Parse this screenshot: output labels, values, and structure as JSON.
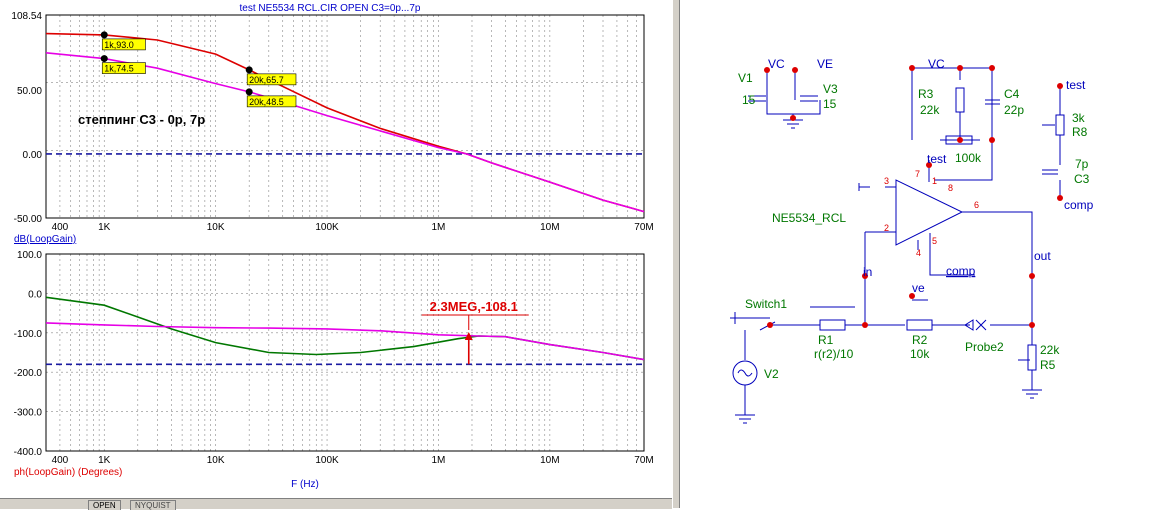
{
  "window_title": "test NE5534 RCL.CIR OPEN C3=0p...7p",
  "tabs": [
    "OPEN",
    "NYQUIST"
  ],
  "colors": {
    "red": "#dd0000",
    "magenta": "#e600e6",
    "green": "#007700",
    "blue_dash": "#1a1aa0",
    "label_bg": "#ffff00",
    "schem_blue": "#0000bb",
    "schem_green": "#007700",
    "node_red": "#dd0000"
  },
  "chart_data": [
    {
      "type": "line",
      "title": "",
      "xlabel": "",
      "ylabel": "dB(LoopGain)",
      "xscale": "log",
      "xlim": [
        300,
        70000000
      ],
      "ylim": [
        -50,
        108.54
      ],
      "x_tick_labels": [
        "400",
        "1K",
        "10K",
        "100K",
        "1M",
        "10M",
        "70M"
      ],
      "x_tick_values": [
        400,
        1000,
        10000,
        100000,
        1000000,
        10000000,
        70000000
      ],
      "y_tick_labels": [
        "108.54",
        "50.00",
        "0.00",
        "-50.00"
      ],
      "y_tick_values": [
        108.54,
        50,
        0,
        -50
      ],
      "grid": true,
      "reference_line": {
        "y": 0,
        "style": "dashed"
      },
      "annotation_text": "степпинг C3 -  0p, 7p",
      "series": [
        {
          "color": "red",
          "x": [
            300,
            1000,
            3000,
            10000,
            20000,
            30000,
            100000,
            300000,
            1000000,
            1800000,
            3000000,
            10000000,
            30000000,
            70000000
          ],
          "y": [
            94,
            93.0,
            89,
            78,
            65.7,
            58,
            36,
            20,
            6,
            0,
            -7,
            -22,
            -36,
            -45
          ]
        },
        {
          "color": "magenta",
          "x": [
            300,
            1000,
            3000,
            10000,
            20000,
            30000,
            100000,
            300000,
            1000000,
            1800000,
            3000000,
            10000000,
            30000000,
            70000000
          ],
          "y": [
            79,
            74.5,
            67,
            55,
            48.5,
            44,
            30,
            18,
            5,
            0,
            -7,
            -22,
            -36,
            -45
          ]
        }
      ],
      "markers": [
        {
          "x": 1000,
          "y": 93.0,
          "label": "1k,93.0"
        },
        {
          "x": 1000,
          "y": 74.5,
          "label": "1k,74.5"
        },
        {
          "x": 20000,
          "y": 65.7,
          "label": "20k,65.7"
        },
        {
          "x": 20000,
          "y": 48.5,
          "label": "20k,48.5"
        }
      ]
    },
    {
      "type": "line",
      "title": "",
      "xlabel": "F (Hz)",
      "ylabel": "ph(LoopGain) (Degrees)",
      "xscale": "log",
      "xlim": [
        300,
        70000000
      ],
      "ylim": [
        -400,
        100
      ],
      "x_tick_labels": [
        "400",
        "1K",
        "10K",
        "100K",
        "1M",
        "10M",
        "70M"
      ],
      "x_tick_values": [
        400,
        1000,
        10000,
        100000,
        1000000,
        10000000,
        70000000
      ],
      "y_tick_labels": [
        "100.0",
        "0.0",
        "-100.0",
        "-200.0",
        "-300.0",
        "-400.0"
      ],
      "y_tick_values": [
        100,
        0,
        -100,
        -200,
        -300,
        -400
      ],
      "grid": true,
      "reference_line": {
        "y": -180,
        "style": "dashed"
      },
      "series": [
        {
          "color": "green",
          "x": [
            300,
            1000,
            2000,
            4000,
            10000,
            30000,
            80000,
            200000,
            600000,
            1500000,
            2300000,
            4000000,
            10000000,
            30000000,
            70000000
          ],
          "y": [
            -10,
            -30,
            -60,
            -90,
            -125,
            -150,
            -155,
            -150,
            -135,
            -115,
            -108.1,
            -110,
            -130,
            -150,
            -168
          ]
        },
        {
          "color": "magenta",
          "x": [
            300,
            1000,
            3000,
            10000,
            30000,
            100000,
            300000,
            1000000,
            2300000,
            4000000,
            10000000,
            30000000,
            70000000
          ],
          "y": [
            -75,
            -80,
            -84,
            -87,
            -88,
            -90,
            -95,
            -105,
            -108.1,
            -110,
            -130,
            -150,
            -168
          ]
        }
      ],
      "markers": [
        {
          "x": 2300000,
          "y": -108.1,
          "label": "2.3MEG,-108.1"
        }
      ]
    }
  ],
  "schematic": {
    "V1": {
      "name": "V1",
      "value": "15",
      "node": "VC"
    },
    "V3": {
      "name": "V3",
      "value": "15",
      "node": "VE"
    },
    "R3": {
      "name": "R3",
      "value": "22k"
    },
    "C4": {
      "name": "C4",
      "value": "22p"
    },
    "top_vc": "VC",
    "pot_value": "100k",
    "test_label": "test",
    "R8": {
      "name": "R8",
      "value": "3k"
    },
    "C3": {
      "name": "C3",
      "value": "7p"
    },
    "test_node": "test",
    "comp_node": "comp",
    "opamp_name": "NE5534_RCL",
    "pins": {
      "p3": "3",
      "p2": "2",
      "p7": "7",
      "p1": "1",
      "p8": "8",
      "p6": "6",
      "p5": "5",
      "p4": "4"
    },
    "comp_label": "comp",
    "ve_label": "ve",
    "in_label": "in",
    "out_label": "out",
    "switch_name": "Switch1",
    "R1": {
      "name": "R1",
      "value": "r(r2)/10"
    },
    "R2": {
      "name": "R2",
      "value": "10k"
    },
    "probe": "Probe2",
    "R5": {
      "name": "R5",
      "value": "22k"
    },
    "V2": {
      "name": "V2"
    }
  }
}
